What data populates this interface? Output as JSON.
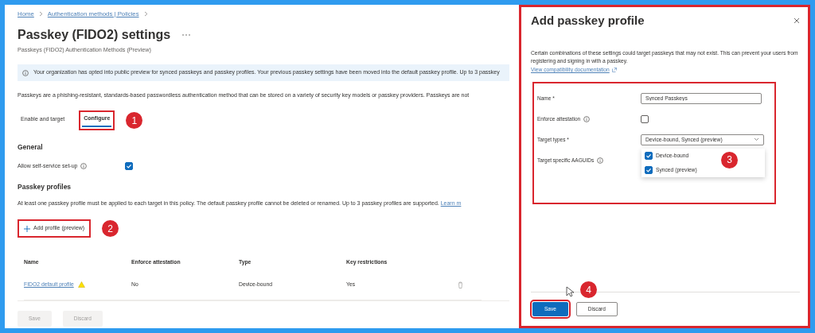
{
  "breadcrumb": [
    {
      "label": "Home"
    },
    {
      "label": "Authentication methods | Policies"
    }
  ],
  "page": {
    "title": "Passkey (FIDO2) settings",
    "subtitle": "Passkeys (FIDO2) Authentication Methods (Preview)"
  },
  "info_banner": "Your organization has opted into public preview for synced passkeys and passkey profiles. Your previous passkey settings have been moved into the default passkey profile. Up to 3 passkey",
  "description": "Passkeys are a phishing-resistant, standards-based passwordless authentication method that can be stored on a variety of security key models or passkey providers. Passkeys are not",
  "tabs": [
    {
      "label": "Enable and target",
      "selected": false
    },
    {
      "label": "Configure",
      "selected": true,
      "callout": "1"
    }
  ],
  "general": {
    "heading": "General",
    "settings": [
      {
        "label": "Allow self-service set-up",
        "info": true,
        "checked": true
      }
    ]
  },
  "profiles": {
    "heading": "Passkey profiles",
    "note": "At least one passkey profile must be applied to each target in this policy. The default passkey profile cannot be deleted or renamed. Up to 3 passkey profiles are supported.",
    "link": "Learn m",
    "add_button": {
      "label": "Add profile (preview)",
      "callout": "2"
    }
  },
  "table": {
    "columns": [
      "Name",
      "Enforce attestation",
      "Type",
      "Key restrictions"
    ],
    "rows": [
      {
        "warning": true,
        "cells": [
          "FIDO2 default profile",
          "No",
          "Device-bound",
          "Yes"
        ]
      }
    ]
  },
  "footer_buttons": [
    {
      "label": "Save",
      "disabled": true
    },
    {
      "label": "Discard",
      "disabled": true
    }
  ],
  "panel": {
    "title": "Add passkey profile",
    "message": "Certain combinations of these settings could target passkeys that may not exist. This can prevent your users from registering and signing in with a passkey.",
    "link": "View compatibility documentation",
    "form": {
      "callout": "3",
      "fields": [
        {
          "kind": "text",
          "label": "Name *",
          "value": "Synced Passkeys"
        },
        {
          "kind": "checkbox",
          "label": "Enforce attestation",
          "info": true,
          "checked": false
        },
        {
          "kind": "select",
          "label": "Target types *",
          "value": "Device-bound, Synced (preview)",
          "expanded": true,
          "options": [
            {
              "label": "Device-bound",
              "checked": true
            },
            {
              "label": "Synced (preview)",
              "checked": true
            }
          ]
        },
        {
          "kind": "label",
          "label": "Target specific AAGUIDs",
          "info": true
        }
      ]
    },
    "buttons": [
      {
        "label": "Save",
        "primary": true,
        "callout": "4"
      },
      {
        "label": "Discard",
        "primary": false
      }
    ]
  }
}
